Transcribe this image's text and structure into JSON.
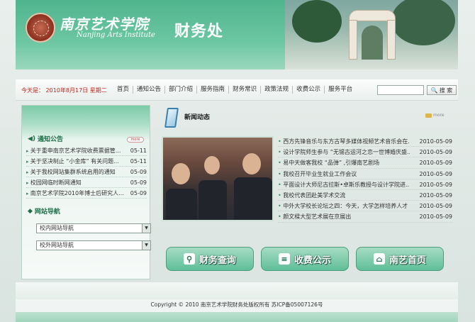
{
  "header": {
    "school_name": "南京艺术学院",
    "school_en": "Nanjing Arts Institute",
    "dept_name": "财务处"
  },
  "nav": {
    "today": "今天是： 2010年8月17日 星期二",
    "items": [
      "首页",
      "通知公告",
      "部门介绍",
      "服务指南",
      "财务常识",
      "政策法规",
      "收费公示",
      "服务平台"
    ],
    "search_placeholder": "",
    "search_label": "搜 索"
  },
  "sidebar": {
    "notice_title": "通知公告",
    "more_label": "more",
    "notices": [
      {
        "title": "关于重申南京艺术学院收费票据管...",
        "date": "05-11"
      },
      {
        "title": "关于坚决制止 “小金库” 有关问题...",
        "date": "05-11"
      },
      {
        "title": "关于我校网站集群系统启用的通知",
        "date": "05-09"
      },
      {
        "title": "校园网临时断网通知",
        "date": "05-09"
      },
      {
        "title": "南京艺术学院2010年博士后研究人...",
        "date": "05-09"
      }
    ],
    "guide_title": "网站导航",
    "select_inner": "校内网站导航",
    "select_outer": "校外网站导航"
  },
  "news": {
    "title": "新闻动态",
    "more_label": "more",
    "items": [
      {
        "title": "西方先锋音乐与东方古琴多媒体视频艺术音乐会在...",
        "date": "2010-05-09"
      },
      {
        "title": "设计学院师生参与 “无锡古运河之恋一世博婚庆盛...",
        "date": "2010-05-09"
      },
      {
        "title": "易中天做客我校 “品弹” ,引爆南艺剧场",
        "date": "2010-05-09"
      },
      {
        "title": "我校召开毕业生就业工作会议",
        "date": "2010-05-09"
      },
      {
        "title": "平面设计大师尼古拉斯•卓斯乐教授与设计学院进...",
        "date": "2010-05-09"
      },
      {
        "title": "我校代表团赴美学术交流",
        "date": "2010-05-09"
      },
      {
        "title": "中外大学校长论坛之四：今天，大学怎样培养人才",
        "date": "2010-05-09"
      },
      {
        "title": "颜文樑大型艺术展在京展出",
        "date": "2010-05-09"
      }
    ]
  },
  "buttons": {
    "finance_query": "财务查询",
    "fee_public": "收费公示",
    "home": "南艺首页"
  },
  "footer": {
    "copyright": "Copyright © 2010 南京艺术学院财务处版权所有   苏ICP备05007126号"
  }
}
